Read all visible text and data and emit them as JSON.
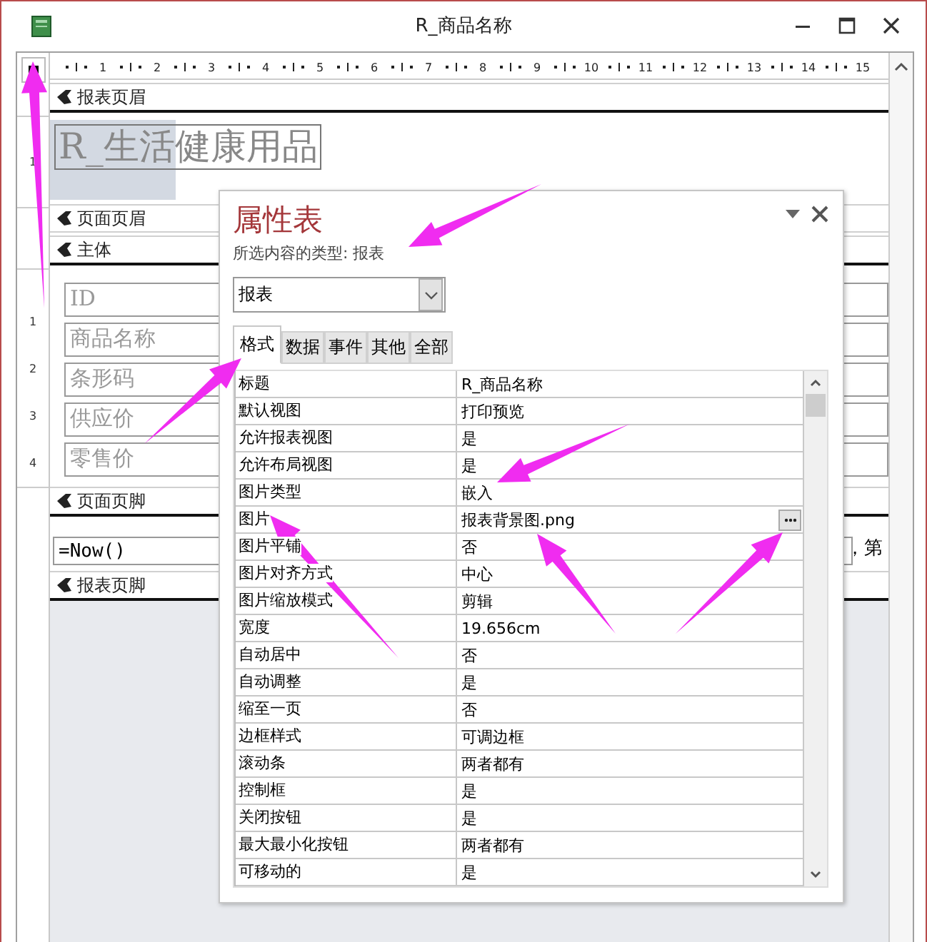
{
  "window": {
    "title": "R_商品名称"
  },
  "ruler": {
    "marks": [
      "1",
      "2",
      "3",
      "4",
      "5",
      "6",
      "7",
      "8",
      "9",
      "10",
      "11",
      "12",
      "13",
      "14",
      "15"
    ],
    "side_header_marks": [
      "1"
    ],
    "side_detail_marks": [
      "1",
      "2",
      "3",
      "4"
    ]
  },
  "report": {
    "report_header": {
      "label": "报表页眉",
      "title": "R_生活健康用品"
    },
    "page_header": {
      "label": "页面页眉"
    },
    "detail": {
      "label": "主体",
      "fields": [
        "ID",
        "商品名称",
        "条形码",
        "供应价",
        "零售价"
      ]
    },
    "page_footer": {
      "label": "页面页脚",
      "expression": "=Now()",
      "trailing_text": "，第"
    },
    "report_footer": {
      "label": "报表页脚"
    }
  },
  "property_sheet": {
    "title": "属性表",
    "selection_type": "所选内容的类型:  报表",
    "object": "报表",
    "tabs": [
      {
        "label": "格式",
        "selected": true
      },
      {
        "label": "数据",
        "selected": false
      },
      {
        "label": "事件",
        "selected": false
      },
      {
        "label": "其他",
        "selected": false
      },
      {
        "label": "全部",
        "selected": false
      }
    ],
    "rows": [
      {
        "name": "标题",
        "value": "R_商品名称",
        "kind": "text"
      },
      {
        "name": "默认视图",
        "value": "打印预览",
        "kind": "text"
      },
      {
        "name": "允许报表视图",
        "value": "是",
        "kind": "text"
      },
      {
        "name": "允许布局视图",
        "value": "是",
        "kind": "text"
      },
      {
        "name": "图片类型",
        "value": "嵌入",
        "kind": "text"
      },
      {
        "name": "图片",
        "value": "报表背景图.png",
        "kind": "builder"
      },
      {
        "name": "图片平铺",
        "value": "否",
        "kind": "text"
      },
      {
        "name": "图片对齐方式",
        "value": "中心",
        "kind": "text"
      },
      {
        "name": "图片缩放模式",
        "value": "剪辑",
        "kind": "text"
      },
      {
        "name": "宽度",
        "value": "19.656cm",
        "kind": "text"
      },
      {
        "name": "自动居中",
        "value": "否",
        "kind": "text"
      },
      {
        "name": "自动调整",
        "value": "是",
        "kind": "text"
      },
      {
        "name": "缩至一页",
        "value": "否",
        "kind": "text"
      },
      {
        "name": "边框样式",
        "value": "可调边框",
        "kind": "text"
      },
      {
        "name": "滚动条",
        "value": "两者都有",
        "kind": "text"
      },
      {
        "name": "控制框",
        "value": "是",
        "kind": "text"
      },
      {
        "name": "关闭按钮",
        "value": "是",
        "kind": "text"
      },
      {
        "name": "最大最小化按钮",
        "value": "两者都有",
        "kind": "text"
      },
      {
        "name": "可移动的",
        "value": "是",
        "kind": "text"
      }
    ]
  }
}
